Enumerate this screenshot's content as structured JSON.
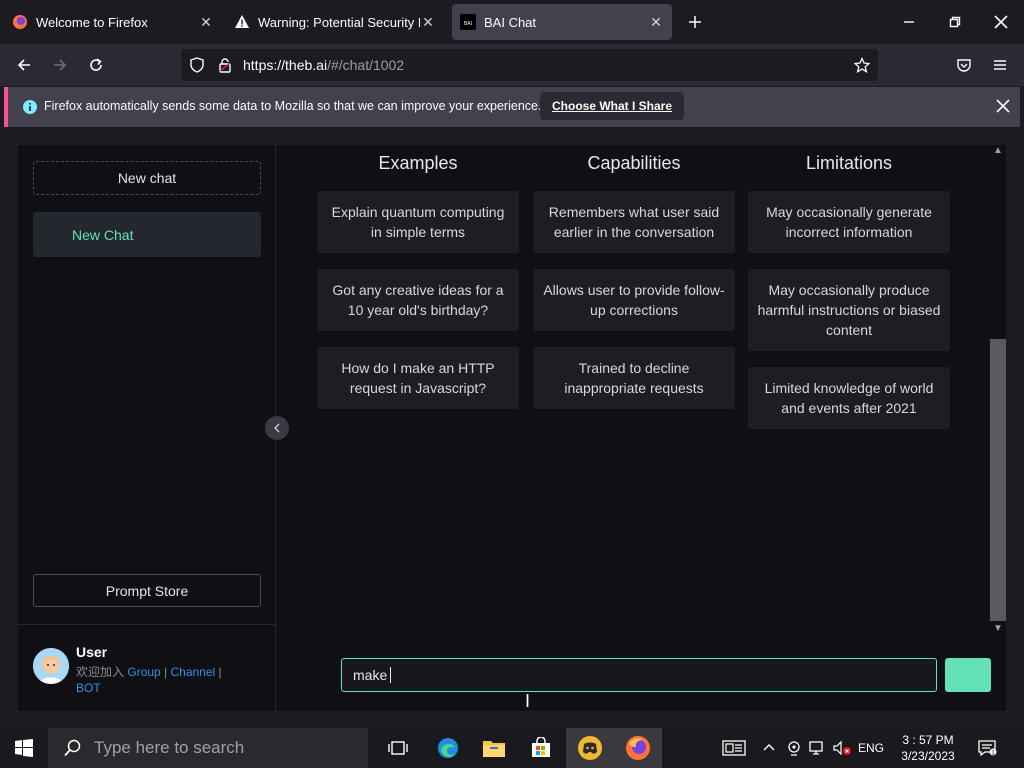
{
  "tabs": [
    {
      "title": "Welcome to Firefox",
      "icon": "firefox-icon"
    },
    {
      "title": "Warning: Potential Security Risk Ahead",
      "icon": "warning-icon"
    },
    {
      "title": "BAI Chat",
      "icon": "bai-icon",
      "active": true
    }
  ],
  "nav": {
    "url_host": "https://theb.ai",
    "url_path": "/#/chat/1002"
  },
  "notification": {
    "text": "Firefox automatically sends some data to Mozilla so that we can improve your experience.",
    "button": "Choose What I Share"
  },
  "sidebar": {
    "new_chat": "New chat",
    "chat_items": [
      {
        "label": "New Chat"
      }
    ],
    "prompt_store": "Prompt Store",
    "user": {
      "name": "User",
      "welcome": "欢迎加入",
      "group": "Group",
      "channel": "Channel",
      "bot": "BOT"
    }
  },
  "main": {
    "columns": [
      {
        "title": "Examples",
        "items": [
          "Explain quantum computing in simple terms",
          "Got any creative ideas for a 10 year old's birthday?",
          "How do I make an HTTP request in Javascript?"
        ]
      },
      {
        "title": "Capabilities",
        "items": [
          "Remembers what user said earlier in the conversation",
          "Allows user to provide follow-up corrections",
          "Trained to decline inappropriate requests"
        ]
      },
      {
        "title": "Limitations",
        "items": [
          "May occasionally generate incorrect information",
          "May occasionally produce harmful instructions or biased content",
          "Limited knowledge of world and events after 2021"
        ]
      }
    ],
    "input_value": "make"
  },
  "taskbar": {
    "search_placeholder": "Type here to search",
    "language": "ENG",
    "time": "3 : 57 PM",
    "date": "3/23/2023"
  },
  "colors": {
    "accent": "#63e2b7",
    "link": "#3a8fe0",
    "notif_stripe": "#ff4f9a"
  }
}
